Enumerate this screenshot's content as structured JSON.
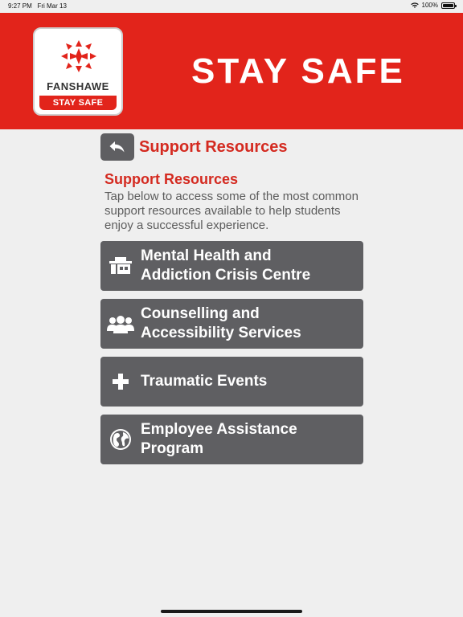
{
  "status_bar": {
    "time": "9:27 PM",
    "date": "Fri Mar 13",
    "battery": "100%"
  },
  "banner": {
    "logo_name": "FANSHAWE",
    "logo_sub": "STAY SAFE",
    "title": "STAY SAFE",
    "brand_color": "#e2241b"
  },
  "header": {
    "back_icon": "back-arrow-icon",
    "title": "Support Resources"
  },
  "section": {
    "title": "Support Resources",
    "description": "Tap below to access some of the most common support resources available to help students enjoy a successful experience."
  },
  "resources": [
    {
      "icon": "building-icon",
      "label_line1": "Mental Health and",
      "label_line2": "Addiction Crisis Centre"
    },
    {
      "icon": "people-icon",
      "label_line1": "Counselling and",
      "label_line2": "Accessibility Services"
    },
    {
      "icon": "plus-icon",
      "label_line1": "Traumatic Events",
      "label_line2": ""
    },
    {
      "icon": "globe-icon",
      "label_line1": "Employee Assistance",
      "label_line2": "Program"
    }
  ],
  "colors": {
    "accent": "#d42a20",
    "button_bg": "#5f5f62",
    "page_bg": "#efefef"
  }
}
